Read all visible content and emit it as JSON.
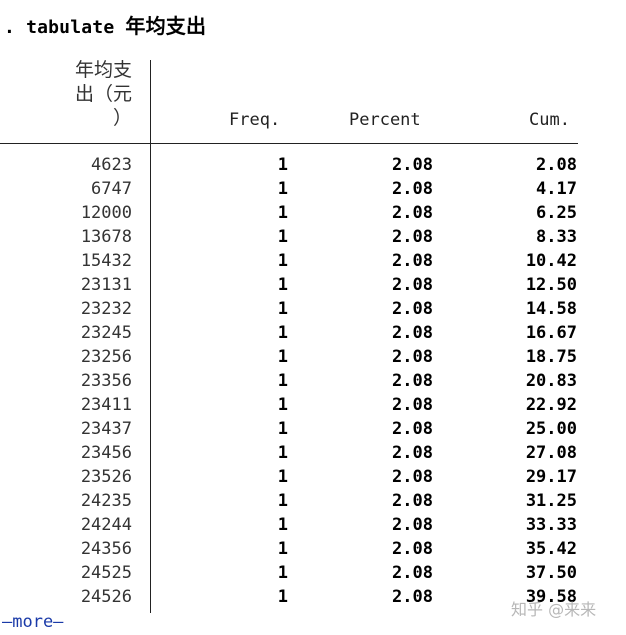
{
  "command": {
    "prefix": ". tabulate ",
    "variable": "年均支出"
  },
  "header": {
    "var_label_lines": [
      "年均支",
      "出（元",
      "）"
    ],
    "freq": "Freq.",
    "percent": "Percent",
    "cum": "Cum."
  },
  "rows": [
    {
      "value": "4623",
      "freq": "1",
      "percent": "2.08",
      "cum": "2.08"
    },
    {
      "value": "6747",
      "freq": "1",
      "percent": "2.08",
      "cum": "4.17"
    },
    {
      "value": "12000",
      "freq": "1",
      "percent": "2.08",
      "cum": "6.25"
    },
    {
      "value": "13678",
      "freq": "1",
      "percent": "2.08",
      "cum": "8.33"
    },
    {
      "value": "15432",
      "freq": "1",
      "percent": "2.08",
      "cum": "10.42"
    },
    {
      "value": "23131",
      "freq": "1",
      "percent": "2.08",
      "cum": "12.50"
    },
    {
      "value": "23232",
      "freq": "1",
      "percent": "2.08",
      "cum": "14.58"
    },
    {
      "value": "23245",
      "freq": "1",
      "percent": "2.08",
      "cum": "16.67"
    },
    {
      "value": "23256",
      "freq": "1",
      "percent": "2.08",
      "cum": "18.75"
    },
    {
      "value": "23356",
      "freq": "1",
      "percent": "2.08",
      "cum": "20.83"
    },
    {
      "value": "23411",
      "freq": "1",
      "percent": "2.08",
      "cum": "22.92"
    },
    {
      "value": "23437",
      "freq": "1",
      "percent": "2.08",
      "cum": "25.00"
    },
    {
      "value": "23456",
      "freq": "1",
      "percent": "2.08",
      "cum": "27.08"
    },
    {
      "value": "23526",
      "freq": "1",
      "percent": "2.08",
      "cum": "29.17"
    },
    {
      "value": "24235",
      "freq": "1",
      "percent": "2.08",
      "cum": "31.25"
    },
    {
      "value": "24244",
      "freq": "1",
      "percent": "2.08",
      "cum": "33.33"
    },
    {
      "value": "24356",
      "freq": "1",
      "percent": "2.08",
      "cum": "35.42"
    },
    {
      "value": "24525",
      "freq": "1",
      "percent": "2.08",
      "cum": "37.50"
    },
    {
      "value": "24526",
      "freq": "1",
      "percent": "2.08",
      "cum": "39.58"
    }
  ],
  "more_label": "—more—",
  "watermark": "知乎 @来来"
}
